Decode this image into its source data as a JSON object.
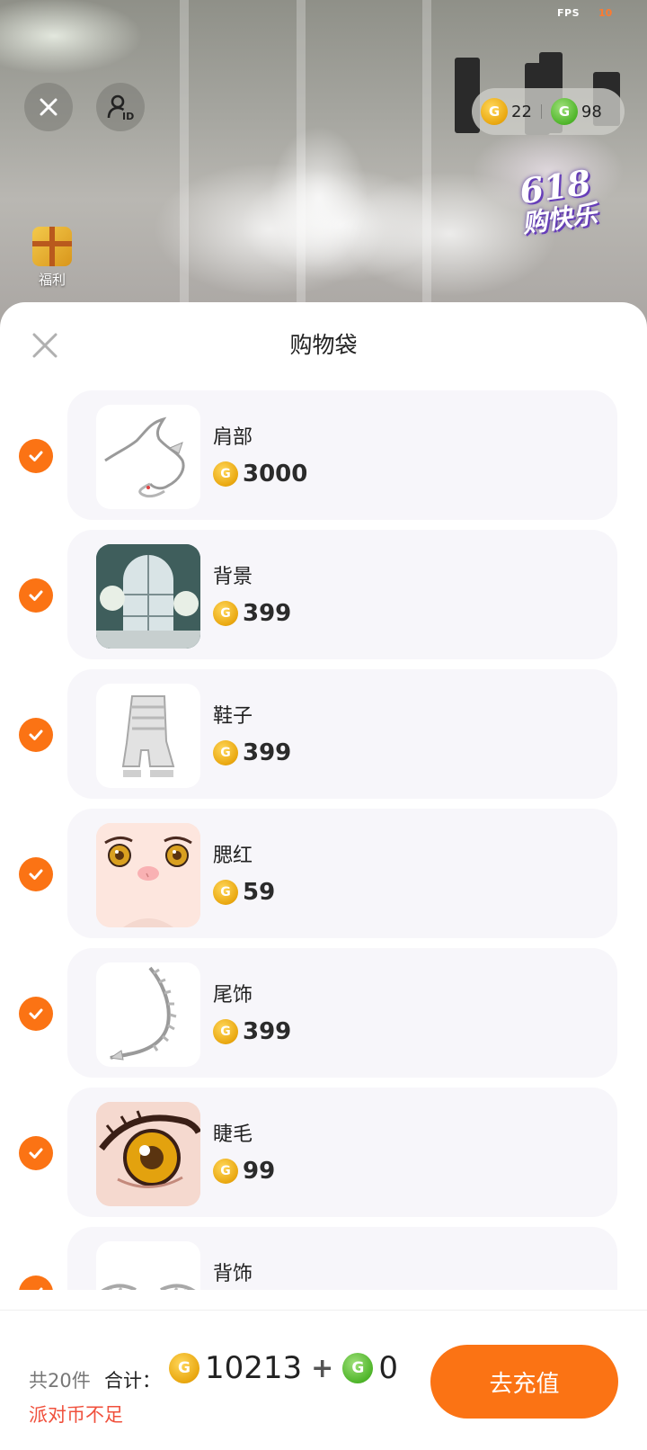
{
  "status": {
    "fps_label": "FPS",
    "fps_value": "10"
  },
  "top": {
    "currency": {
      "gold_amount": "22",
      "green_amount": "98"
    },
    "promo_badge": {
      "number": "618",
      "text": "购快乐"
    },
    "welfare_label": "福利"
  },
  "sheet": {
    "title": "购物袋",
    "items": [
      {
        "name": "肩部",
        "price": "3000",
        "selected": true,
        "thumb_icon": "dragon-shoulder-icon"
      },
      {
        "name": "背景",
        "price": "399",
        "selected": true,
        "thumb_icon": "window-background-icon"
      },
      {
        "name": "鞋子",
        "price": "399",
        "selected": true,
        "thumb_icon": "boots-icon"
      },
      {
        "name": "腮红",
        "price": "59",
        "selected": true,
        "thumb_icon": "face-blush-icon"
      },
      {
        "name": "尾饰",
        "price": "399",
        "selected": true,
        "thumb_icon": "tail-icon"
      },
      {
        "name": "睫毛",
        "price": "99",
        "selected": true,
        "thumb_icon": "eyelash-icon"
      },
      {
        "name": "背饰",
        "price": "",
        "selected": true,
        "thumb_icon": "back-ornament-icon"
      }
    ]
  },
  "footer": {
    "count_text": "共20件",
    "total_label": "合计：",
    "gold_total": "10213",
    "plus": "+",
    "green_total": "0",
    "warning": "派对币不足",
    "recharge_label": "去充值"
  },
  "colors": {
    "accent": "#fb7314",
    "warning": "#f0503c",
    "card_bg": "#f7f6fa"
  }
}
